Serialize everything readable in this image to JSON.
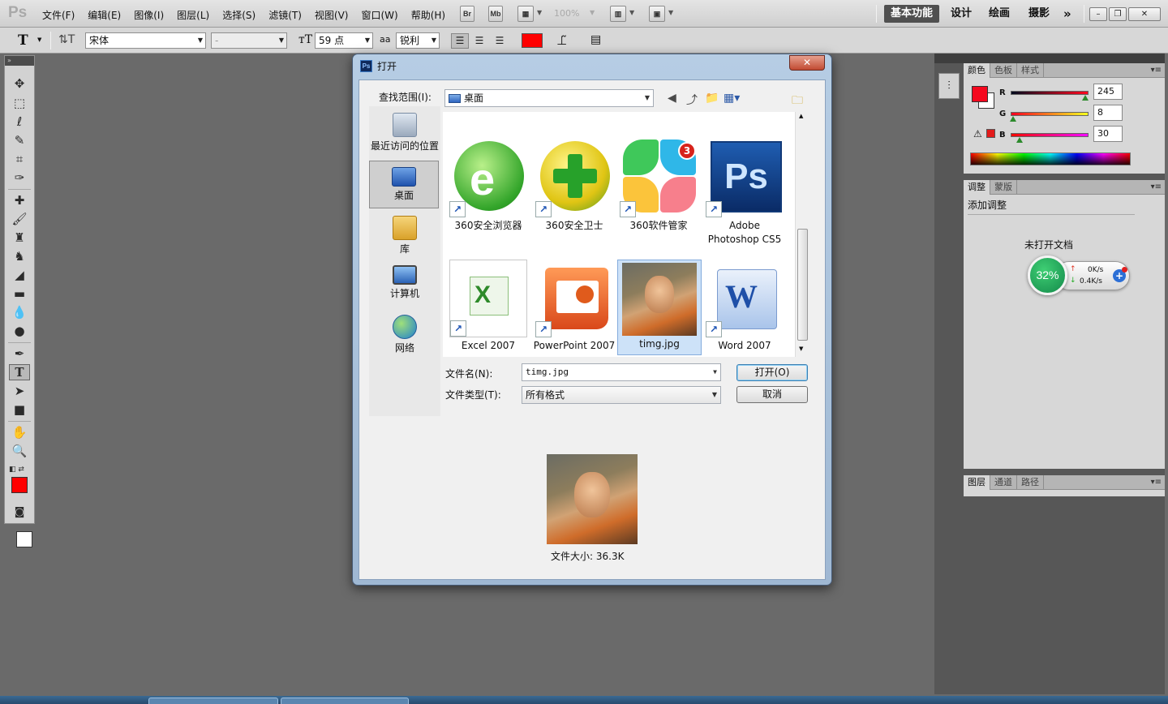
{
  "app": {
    "logo": "Ps",
    "menu": [
      "文件(F)",
      "编辑(E)",
      "图像(I)",
      "图层(L)",
      "选择(S)",
      "滤镜(T)",
      "视图(V)",
      "窗口(W)",
      "帮助(H)"
    ],
    "bridge_label": "Br",
    "mini_bridge_label": "Mb",
    "zoom": "100%",
    "workspaces": [
      "基本功能",
      "设计",
      "绘画",
      "摄影"
    ],
    "more_workspaces": "»"
  },
  "options_bar": {
    "font_family": "宋体",
    "font_style": "-",
    "font_size": "59 点",
    "antialias_label": "aa",
    "antialias": "锐利",
    "text_color": "#ff0000"
  },
  "toolbox": {
    "foreground": "#ff0000",
    "background": "#ffffff"
  },
  "panels": {
    "color_tabs": [
      "颜色",
      "色板",
      "样式"
    ],
    "color": {
      "r_label": "R",
      "g_label": "G",
      "b_label": "B",
      "r": 245,
      "g": 8,
      "b": 30,
      "r_value": "245",
      "g_value": "8",
      "b_value": "30",
      "swatch": "#f5081e"
    },
    "adjust_tabs": [
      "调整",
      "蒙版"
    ],
    "adjust_title": "添加调整",
    "no_document": "未打开文档",
    "layers_tabs": [
      "图层",
      "通道",
      "路径"
    ]
  },
  "speed_widget": {
    "percent": "32%",
    "upload": "0K/s",
    "download": "0.4K/s",
    "up_arrow": "↑",
    "down_arrow": "↓",
    "plus": "+"
  },
  "dialog": {
    "icon": "Ps",
    "title": "打开",
    "close_label": "✕",
    "look_in_label": "查找范围(I):",
    "look_in_value": "桌面",
    "places": [
      {
        "label": "最近访问的位置",
        "icon": "recent-places-icon"
      },
      {
        "label": "桌面",
        "icon": "desktop-icon"
      },
      {
        "label": "库",
        "icon": "library-icon"
      },
      {
        "label": "计算机",
        "icon": "computer-icon"
      },
      {
        "label": "网络",
        "icon": "network-icon"
      }
    ],
    "files": [
      {
        "name": "360安全浏览器",
        "icon": "browser-360-icon"
      },
      {
        "name": "360安全卫士",
        "icon": "safe-360-icon"
      },
      {
        "name": "360软件管家",
        "icon": "software-manager-360-icon",
        "badge": "3"
      },
      {
        "name": "Adobe\nPhotoshop CS5",
        "icon": "photoshop-icon"
      },
      {
        "name": "Excel 2007",
        "icon": "excel-icon"
      },
      {
        "name": "PowerPoint 2007",
        "icon": "powerpoint-icon"
      },
      {
        "name": "timg.jpg",
        "icon": "image-thumbnail"
      },
      {
        "name": "Word 2007",
        "icon": "word-icon"
      }
    ],
    "filename_label": "文件名(N):",
    "filename_value": "timg.jpg",
    "filetype_label": "文件类型(T):",
    "filetype_value": "所有格式",
    "open_button": "打开(O)",
    "cancel_button": "取消",
    "file_size": "文件大小: 36.3K"
  }
}
